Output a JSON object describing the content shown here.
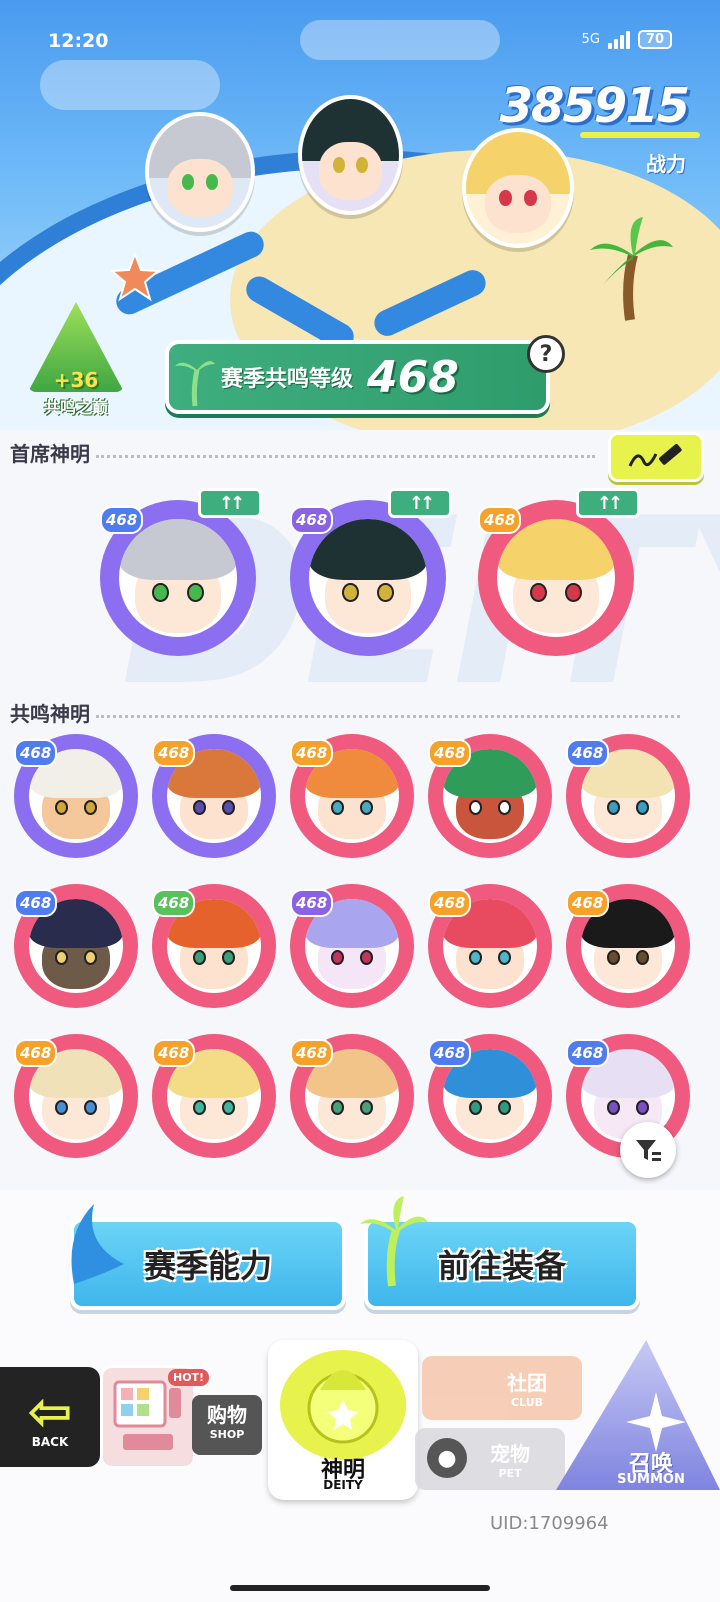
{
  "status_bar": {
    "time": "12:20",
    "network": "5G",
    "battery": "70"
  },
  "power": {
    "value": "385915",
    "label": "战力"
  },
  "peak_badge": {
    "bonus": "+36",
    "label": "共鸣之巅"
  },
  "season": {
    "label": "赛季共鸣等级",
    "level": "468",
    "help_symbol": "?"
  },
  "sections": {
    "leaders_title": "首席神明",
    "resonance_title": "共鸣神明",
    "watermark": "DEITY"
  },
  "leaders": [
    {
      "level": "468",
      "badge": "blue",
      "upgrade": "↑↑",
      "ring": "#8b6ff0",
      "hair": "#c6c9d2",
      "face": "#fde7d6",
      "eye": "#47b84d"
    },
    {
      "level": "468",
      "badge": "purple",
      "upgrade": "↑↑",
      "ring": "#8b6ff0",
      "hair": "#1e3133",
      "face": "#fde7d6",
      "eye": "#d2b33a"
    },
    {
      "level": "468",
      "badge": "orange",
      "upgrade": "↑↑",
      "ring": "#f05a7e",
      "hair": "#f6d36a",
      "face": "#fde7d6",
      "eye": "#d4384a"
    }
  ],
  "resonance": [
    {
      "level": "468",
      "badge": "blue",
      "ring": "#8b6ff0",
      "hair": "#f2efe8",
      "face": "#f5c89c",
      "eye": "#d3a63a"
    },
    {
      "level": "468",
      "badge": "orange",
      "ring": "#8b6ff0",
      "hair": "#d9783a",
      "face": "#fde3cf",
      "eye": "#5a4db0"
    },
    {
      "level": "468",
      "badge": "orange",
      "ring": "#f05a7e",
      "hair": "#f08a3c",
      "face": "#fde3cf",
      "eye": "#4aa9c0"
    },
    {
      "level": "468",
      "badge": "orange",
      "ring": "#f05a7e",
      "hair": "#2f9c5a",
      "face": "#c9553d",
      "eye": "#ffffff"
    },
    {
      "level": "468",
      "badge": "blue",
      "ring": "#f05a7e",
      "hair": "#f3e2b2",
      "face": "#fde7d6",
      "eye": "#3a9ec0"
    },
    {
      "level": "468",
      "badge": "blue",
      "ring": "#f05a7e",
      "hair": "#2a2c4e",
      "face": "#6d5a48",
      "eye": "#f0d070"
    },
    {
      "level": "468",
      "badge": "green",
      "ring": "#f05a7e",
      "hair": "#e5622c",
      "face": "#fde3cf",
      "eye": "#3aa07a"
    },
    {
      "level": "468",
      "badge": "purple",
      "ring": "#f05a7e",
      "hair": "#a9a5ee",
      "face": "#f4e6f6",
      "eye": "#c2355a"
    },
    {
      "level": "468",
      "badge": "orange",
      "ring": "#f05a7e",
      "hair": "#e84a5f",
      "face": "#fde3cf",
      "eye": "#4fb5c9"
    },
    {
      "level": "468",
      "badge": "orange",
      "ring": "#f05a7e",
      "hair": "#1a1a1a",
      "face": "#fde7d6",
      "eye": "#6a4c2a"
    },
    {
      "level": "468",
      "badge": "orange",
      "ring": "#f05a7e",
      "hair": "#f1e1b8",
      "face": "#fde7d6",
      "eye": "#4a8fd2"
    },
    {
      "level": "468",
      "badge": "orange",
      "ring": "#f05a7e",
      "hair": "#f4dc86",
      "face": "#fde7d6",
      "eye": "#3fb6a0"
    },
    {
      "level": "468",
      "badge": "orange",
      "ring": "#f05a7e",
      "hair": "#f2c489",
      "face": "#fde7d6",
      "eye": "#4aa07a"
    },
    {
      "level": "468",
      "badge": "blue",
      "ring": "#f05a7e",
      "hair": "#2f8fd8",
      "face": "#fde7d6",
      "eye": "#2f9c7e"
    },
    {
      "level": "468",
      "badge": "blue",
      "ring": "#f05a7e",
      "hair": "#e7dff4",
      "face": "#f6e8f4",
      "eye": "#7b4fc2"
    }
  ],
  "actions": {
    "season_ability": "赛季能力",
    "go_equipment": "前往装备"
  },
  "nav": {
    "back": "BACK",
    "shop_cn": "购物",
    "shop_en": "SHOP",
    "shop_hot": "HOT!",
    "deity_cn": "神明",
    "deity_en": "DEITY",
    "club_cn": "社团",
    "club_en": "CLUB",
    "pet_cn": "宠物",
    "pet_en": "PET",
    "summon_cn": "召唤",
    "summon_en": "SUMMON"
  },
  "uid": "UID:1709964",
  "colors": {
    "accent_green": "#3fae7e",
    "accent_yellow": "#e7f24c",
    "sky_blue": "#4a9bf0",
    "action_blue": "#3fb6ec"
  }
}
